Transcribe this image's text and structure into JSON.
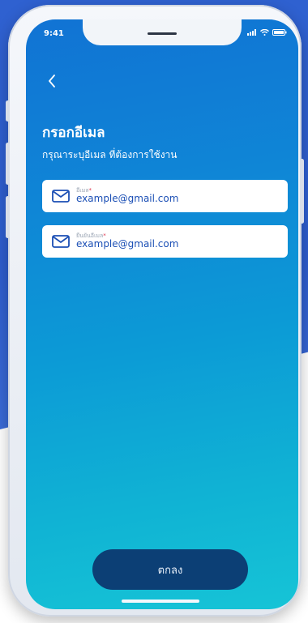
{
  "status_bar": {
    "time": "9:41",
    "icons": [
      "signal-icon",
      "wifi-icon",
      "battery-icon"
    ]
  },
  "nav": {
    "back_icon": "chevron-left-icon"
  },
  "page": {
    "title": "กรอกอีเมล",
    "subtitle": "กรุณาระบุอีเมล ที่ต้องการใช้งาน"
  },
  "form": {
    "fields": [
      {
        "icon": "mail-icon",
        "label": "อีเมล",
        "required_mark": "*",
        "value": "example@gmail.com"
      },
      {
        "icon": "mail-icon",
        "label": "ยืนยันอีเมล",
        "required_mark": "*",
        "value": "example@gmail.com"
      }
    ]
  },
  "actions": {
    "confirm_label": "ตกลง"
  },
  "colors": {
    "screen_gradient_top": "#1173d4",
    "screen_gradient_bottom": "#16c4d6",
    "button_bg": "#0c3f75",
    "field_value": "#1b4fb5",
    "required_star": "#e0344d",
    "page_background_blob": "#2f61d0"
  }
}
